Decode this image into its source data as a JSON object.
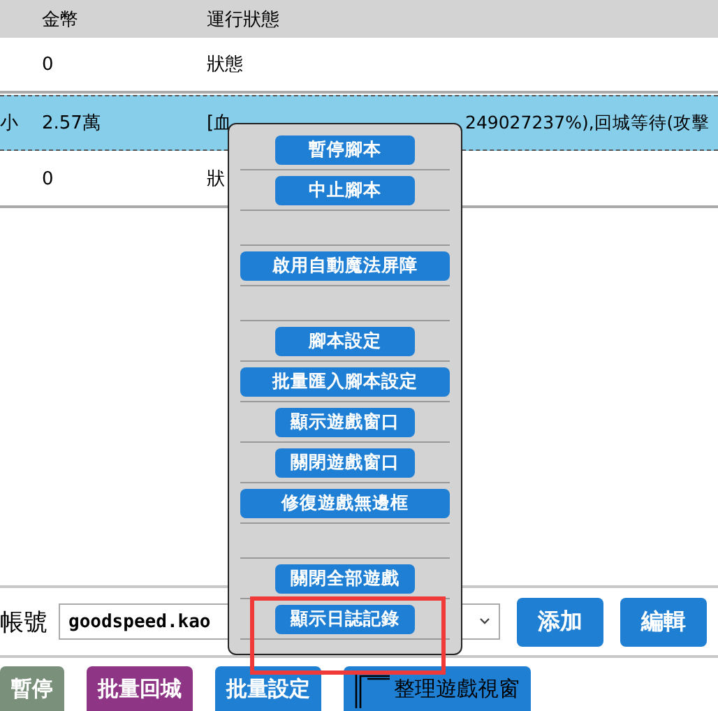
{
  "table": {
    "columns": [
      "金幣",
      "運行狀態"
    ],
    "rows": [
      {
        "column_1": "",
        "coins": "0",
        "status": "狀態",
        "selected": false
      },
      {
        "column_1": "小",
        "coins": "2.57萬",
        "status": "[血",
        "status_continued": "249027237%),回城等待(攻擊",
        "selected": true
      },
      {
        "column_1": "",
        "coins": "0",
        "status": "狀",
        "selected": false
      }
    ]
  },
  "context_menu": {
    "items": [
      {
        "kind": "button",
        "label": "暫停腳本",
        "wide": false,
        "highlighted": false
      },
      {
        "kind": "button",
        "label": "中止腳本",
        "wide": false,
        "highlighted": false
      },
      {
        "kind": "spacer"
      },
      {
        "kind": "button",
        "label": "啟用自動魔法屏障",
        "wide": true,
        "highlighted": false
      },
      {
        "kind": "spacer"
      },
      {
        "kind": "button",
        "label": "腳本設定",
        "wide": false,
        "highlighted": false
      },
      {
        "kind": "button",
        "label": "批量匯入腳本設定",
        "wide": true,
        "highlighted": false
      },
      {
        "kind": "button",
        "label": "顯示遊戲窗口",
        "wide": false,
        "highlighted": false
      },
      {
        "kind": "button",
        "label": "關閉遊戲窗口",
        "wide": false,
        "highlighted": false
      },
      {
        "kind": "button",
        "label": "修復遊戲無邊框",
        "wide": true,
        "highlighted": false
      },
      {
        "kind": "spacer"
      },
      {
        "kind": "button",
        "label": "關閉全部遊戲",
        "wide": false,
        "highlighted": false
      },
      {
        "kind": "button",
        "label": "顯示日誌記錄",
        "wide": false,
        "highlighted": true
      }
    ]
  },
  "account": {
    "label": "帳號",
    "value": "goodspeed.kao",
    "buttons": [
      "添加",
      "編輯"
    ]
  },
  "actions": [
    {
      "label": "暫停",
      "color": "#7b907b",
      "kind": "button"
    },
    {
      "label": "批量回城",
      "color": "#8e3586",
      "kind": "button"
    },
    {
      "label": "批量設定",
      "color": "#1f7fd3",
      "kind": "button"
    },
    {
      "label": "整理遊戲視窗",
      "color": "#1f7fd3",
      "kind": "window"
    }
  ]
}
